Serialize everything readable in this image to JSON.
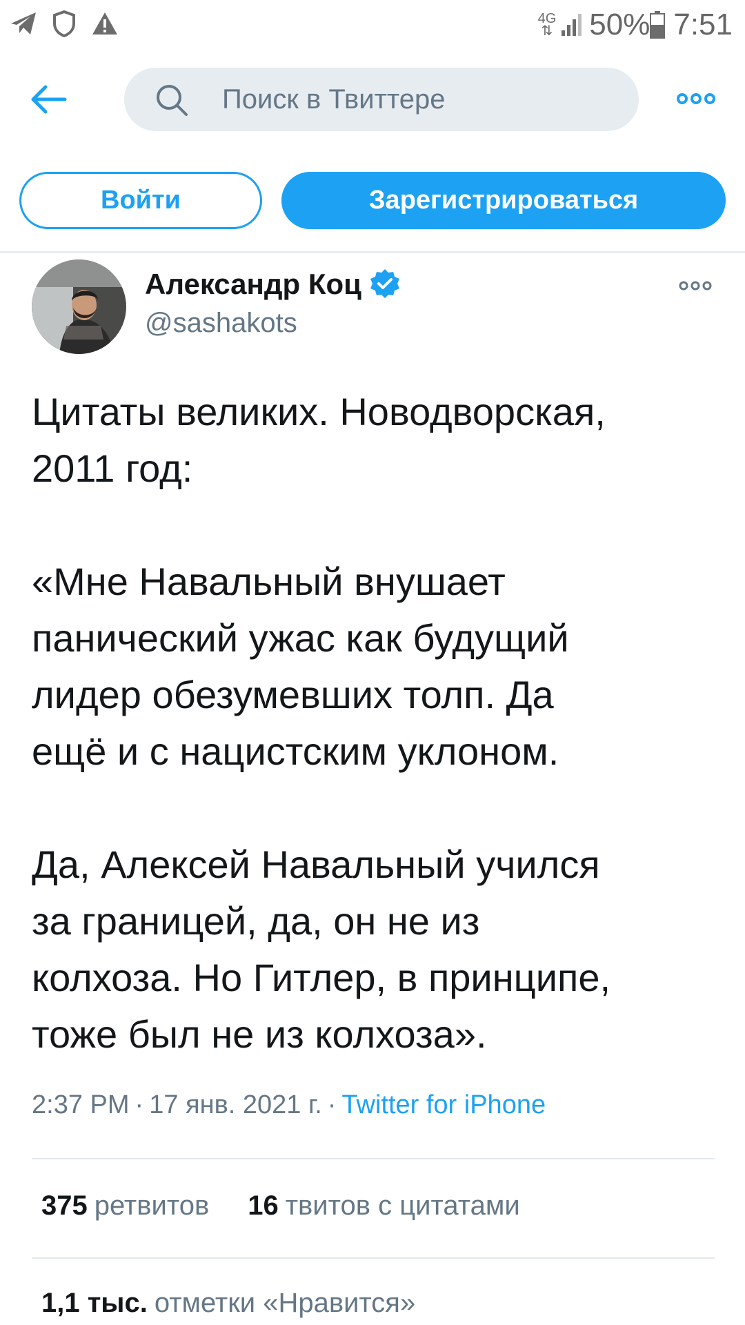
{
  "status_bar": {
    "network": "4G",
    "battery": "50%",
    "time": "7:51",
    "icons": [
      "telegram-icon",
      "shield-icon",
      "warning-icon",
      "signal-icon",
      "battery-icon"
    ]
  },
  "header": {
    "search_placeholder": "Поиск в Твиттере",
    "icons": [
      "back-arrow-icon",
      "search-icon",
      "more-icon"
    ]
  },
  "auth": {
    "login_label": "Войти",
    "signup_label": "Зарегистрироваться"
  },
  "tweet": {
    "author_name": "Александр Коц",
    "author_handle": "@sashakots",
    "verified": true,
    "paragraphs": [
      "Цитаты великих. Новодворская,\n2011 год:",
      "«Мне Навальный внушает\nпанический ужас как будущий\nлидер обезумевших толп. Да\nещё и с нацистским уклоном.",
      "Да, Алексей Навальный учился\nза границей, да, он не из\nколхоза. Но Гитлер, в принципе,\nтоже был не из колхоза»."
    ],
    "time": "2:37 PM",
    "date": "17 янв. 2021 г.",
    "separator": "·",
    "source": "Twitter for iPhone",
    "retweets_count": "375",
    "retweets_label": "ретвитов",
    "quotes_count": "16",
    "quotes_label": "твитов с цитатами",
    "likes_count": "1,1 тыс.",
    "likes_label": "отметки «Нравится»"
  },
  "colors": {
    "accent": "#1da1f2",
    "text": "#14171a",
    "secondary": "#657786",
    "search_bg": "#e6ecf0"
  }
}
